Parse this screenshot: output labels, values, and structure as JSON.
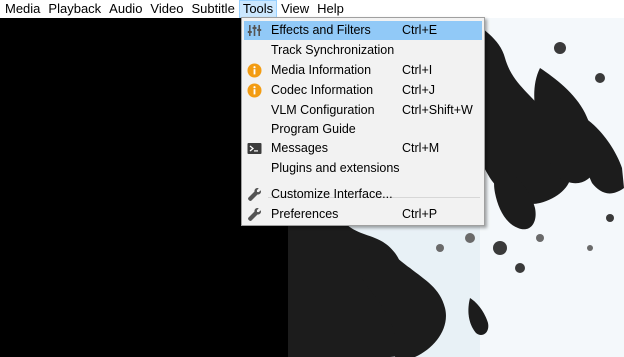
{
  "menubar": {
    "items": [
      {
        "label": "Media"
      },
      {
        "label": "Playback"
      },
      {
        "label": "Audio"
      },
      {
        "label": "Video"
      },
      {
        "label": "Subtitle"
      },
      {
        "label": "Tools"
      },
      {
        "label": "View"
      },
      {
        "label": "Help"
      }
    ],
    "active_item": "Tools"
  },
  "tools_menu": {
    "items": [
      {
        "label": "Effects and Filters",
        "shortcut": "Ctrl+E",
        "icon": "equalizer-icon",
        "highlighted": true
      },
      {
        "label": "Track Synchronization",
        "shortcut": "",
        "icon": ""
      },
      {
        "label": "Media Information",
        "shortcut": "Ctrl+I",
        "icon": "info-icon"
      },
      {
        "label": "Codec Information",
        "shortcut": "Ctrl+J",
        "icon": "info-icon"
      },
      {
        "label": "VLM Configuration",
        "shortcut": "Ctrl+Shift+W",
        "icon": ""
      },
      {
        "label": "Program Guide",
        "shortcut": "",
        "icon": ""
      },
      {
        "label": "Messages",
        "shortcut": "Ctrl+M",
        "icon": "terminal-icon"
      },
      {
        "label": "Plugins and extensions",
        "shortcut": "",
        "icon": ""
      },
      {
        "label": "Customize Interface...",
        "shortcut": "",
        "icon": "wrench-icon"
      },
      {
        "label": "Preferences",
        "shortcut": "Ctrl+P",
        "icon": "wrench-icon"
      }
    ]
  },
  "colors": {
    "highlight": "#91c9f7",
    "info_icon": "#f39c12",
    "menu_background": "#f2f2f2",
    "video_background": "#000000"
  }
}
